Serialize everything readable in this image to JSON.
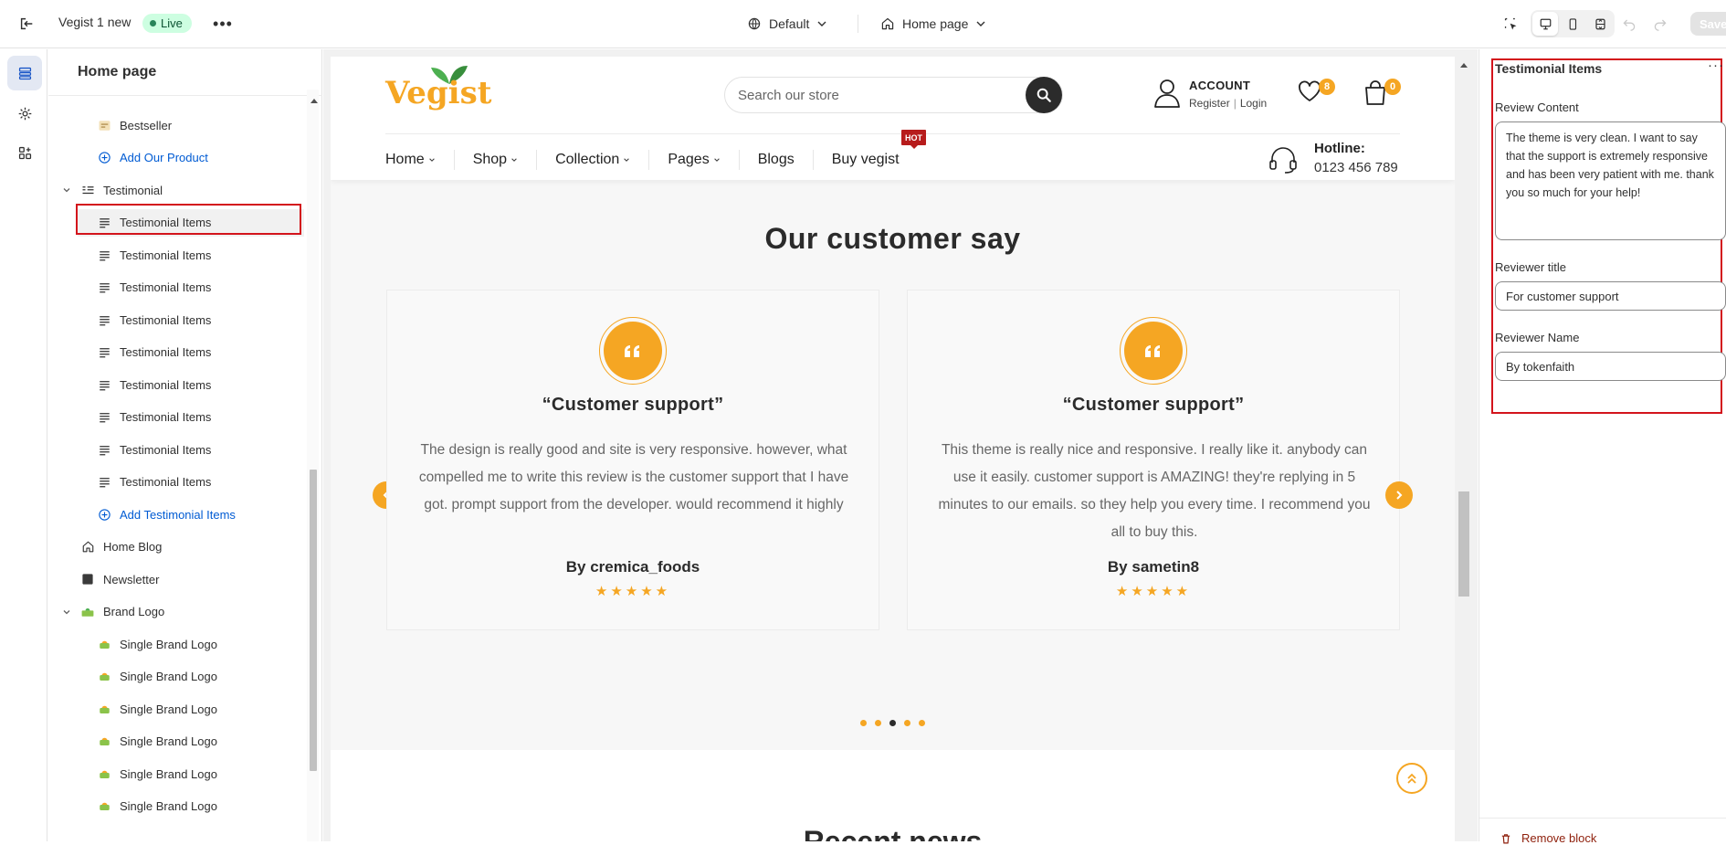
{
  "topbar": {
    "theme_name": "Vegist 1 new",
    "live_label": "Live",
    "more_label": "•••",
    "template": "Default",
    "page": "Home page",
    "save_label": "Save"
  },
  "sidebar": {
    "title": "Home page",
    "items": [
      {
        "label": "Bestseller",
        "icon": "product-thumb-icon",
        "level": 2,
        "type": "item"
      },
      {
        "label": "Add Our Product",
        "icon": "plus-circle-icon",
        "level": 2,
        "type": "link"
      },
      {
        "label": "Testimonial",
        "icon": "testimonial-section-icon",
        "level": 1,
        "type": "group"
      },
      {
        "label": "Testimonial Items",
        "icon": "text-block-icon",
        "level": 2,
        "type": "item",
        "selected": true
      },
      {
        "label": "Testimonial Items",
        "icon": "text-block-icon",
        "level": 2,
        "type": "item"
      },
      {
        "label": "Testimonial Items",
        "icon": "text-block-icon",
        "level": 2,
        "type": "item"
      },
      {
        "label": "Testimonial Items",
        "icon": "text-block-icon",
        "level": 2,
        "type": "item"
      },
      {
        "label": "Testimonial Items",
        "icon": "text-block-icon",
        "level": 2,
        "type": "item"
      },
      {
        "label": "Testimonial Items",
        "icon": "text-block-icon",
        "level": 2,
        "type": "item"
      },
      {
        "label": "Testimonial Items",
        "icon": "text-block-icon",
        "level": 2,
        "type": "item"
      },
      {
        "label": "Testimonial Items",
        "icon": "text-block-icon",
        "level": 2,
        "type": "item"
      },
      {
        "label": "Testimonial Items",
        "icon": "text-block-icon",
        "level": 2,
        "type": "item"
      },
      {
        "label": "Add Testimonial Items",
        "icon": "plus-circle-icon",
        "level": 2,
        "type": "link"
      },
      {
        "label": "Home Blog",
        "icon": "home-icon",
        "level": 1,
        "type": "section"
      },
      {
        "label": "Newsletter",
        "icon": "newsletter-icon",
        "level": 1,
        "type": "section"
      },
      {
        "label": "Brand Logo",
        "icon": "brand-logo-icon",
        "level": 1,
        "type": "group"
      },
      {
        "label": "Single Brand Logo",
        "icon": "brand-thumb-icon",
        "level": 2,
        "type": "item"
      },
      {
        "label": "Single Brand Logo",
        "icon": "brand-thumb-icon",
        "level": 2,
        "type": "item"
      },
      {
        "label": "Single Brand Logo",
        "icon": "brand-thumb-icon",
        "level": 2,
        "type": "item"
      },
      {
        "label": "Single Brand Logo",
        "icon": "brand-thumb-icon",
        "level": 2,
        "type": "item"
      },
      {
        "label": "Single Brand Logo",
        "icon": "brand-thumb-icon",
        "level": 2,
        "type": "item"
      },
      {
        "label": "Single Brand Logo",
        "icon": "brand-thumb-icon",
        "level": 2,
        "type": "item"
      }
    ]
  },
  "store": {
    "logo_text": "Vegist",
    "search_placeholder": "Search our store",
    "account_label": "ACCOUNT",
    "register_label": "Register",
    "login_label": "Login",
    "account_sep": "|",
    "wishlist_count": "8",
    "cart_count": "0",
    "nav": [
      {
        "label": "Home",
        "caret": true
      },
      {
        "label": "Shop",
        "caret": true
      },
      {
        "label": "Collection",
        "caret": true
      },
      {
        "label": "Pages",
        "caret": true
      },
      {
        "label": "Blogs",
        "caret": false
      },
      {
        "label": "Buy vegist",
        "caret": false
      }
    ],
    "hot_badge": "HOT",
    "hotline_label": "Hotline:",
    "hotline_number": "0123 456 789"
  },
  "testimonials": {
    "heading": "Our customer say",
    "cards": [
      {
        "title": "“Customer support”",
        "body": "The design is really good and site is very responsive. however, what compelled me to write this review is the customer support that I have got. prompt support from the developer. would recommend it highly",
        "author": "By cremica_foods",
        "rating": 5
      },
      {
        "title": "“Customer support”",
        "body": "This theme is really nice and responsive. I really like it. anybody can use it easily. customer support is AMAZING! they're replying in 5 minutes to our emails. so they help you every time. I recommend you all to buy this.",
        "author": "By sametin8",
        "rating": 5
      }
    ],
    "dots_total": 5,
    "dots_active": 3,
    "next_heading": "Recent news"
  },
  "settings": {
    "title": "Testimonial Items",
    "review_content_label": "Review Content",
    "review_content_value": "The theme is very clean. I want to say that the support is extremely responsive and has been very patient with me. thank you so much for your help!",
    "reviewer_title_label": "Reviewer title",
    "reviewer_title_value": "For customer support",
    "reviewer_name_label": "Reviewer Name",
    "reviewer_name_value": "By tokenfaith",
    "remove_label": "Remove block"
  },
  "colors": {
    "accent": "#f5a623",
    "highlight_border": "#d3141c",
    "link": "#005bd3",
    "live_bg": "#cdfee1"
  }
}
